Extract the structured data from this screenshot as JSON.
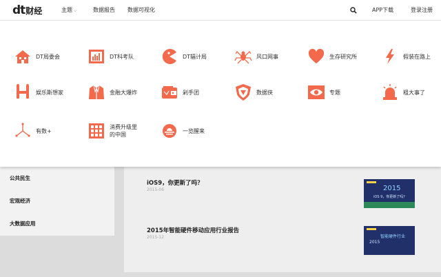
{
  "header": {
    "logo_mark": "dt",
    "logo_text": "财经",
    "nav": [
      {
        "label": "主题"
      },
      {
        "label": "数据报告"
      },
      {
        "label": "数据可视化"
      }
    ],
    "app_download": "APP下载",
    "login": "登录注册"
  },
  "colors": {
    "accent": "#f26a4b",
    "header_bg": "#ffffff",
    "page_bg": "#dcdcdc"
  },
  "topics": [
    {
      "label": "DT局委会",
      "icon": "house-icon"
    },
    {
      "label": "DT科考队",
      "icon": "chart-screen-icon"
    },
    {
      "label": "DT辐计局",
      "icon": "pacman-icon"
    },
    {
      "label": "风口网事",
      "icon": "spider-icon"
    },
    {
      "label": "生存研究所",
      "icon": "heart-icon"
    },
    {
      "label": "假装在路上",
      "icon": "lightning-icon"
    },
    {
      "label": "娱乐斯想家",
      "icon": "h-icon"
    },
    {
      "label": "金融大爆炸",
      "icon": "jacket-icon"
    },
    {
      "label": "剁手团",
      "icon": "wallet-icon"
    },
    {
      "label": "数据侠",
      "icon": "shield-icon"
    },
    {
      "label": "专题",
      "icon": "eye-icon"
    },
    {
      "label": "粗大事了",
      "icon": "siren-icon"
    },
    {
      "label": "有数+",
      "icon": "axes-icon"
    },
    {
      "label": "消费升级里的中国",
      "label_line1": "消费升级里",
      "label_line2": "的中国",
      "icon": "grid-icon"
    },
    {
      "label": "一览醒来",
      "icon": "sunrise-icon"
    }
  ],
  "sidebar": {
    "items": [
      {
        "label": "公共民生"
      },
      {
        "label": "宏观经济"
      },
      {
        "label": "大数据应用"
      }
    ]
  },
  "articles": [
    {
      "title": "iOS9，你更新了吗？",
      "date": "2015-06",
      "thumb_text": "2015",
      "thumb_sub": "iOS 9，你更新了吗？"
    },
    {
      "title": "2015年智能硬件移动应用行业报告",
      "date": "2015-12",
      "thumb_text": "智能硬件行业",
      "thumb_sub": "2015"
    }
  ]
}
